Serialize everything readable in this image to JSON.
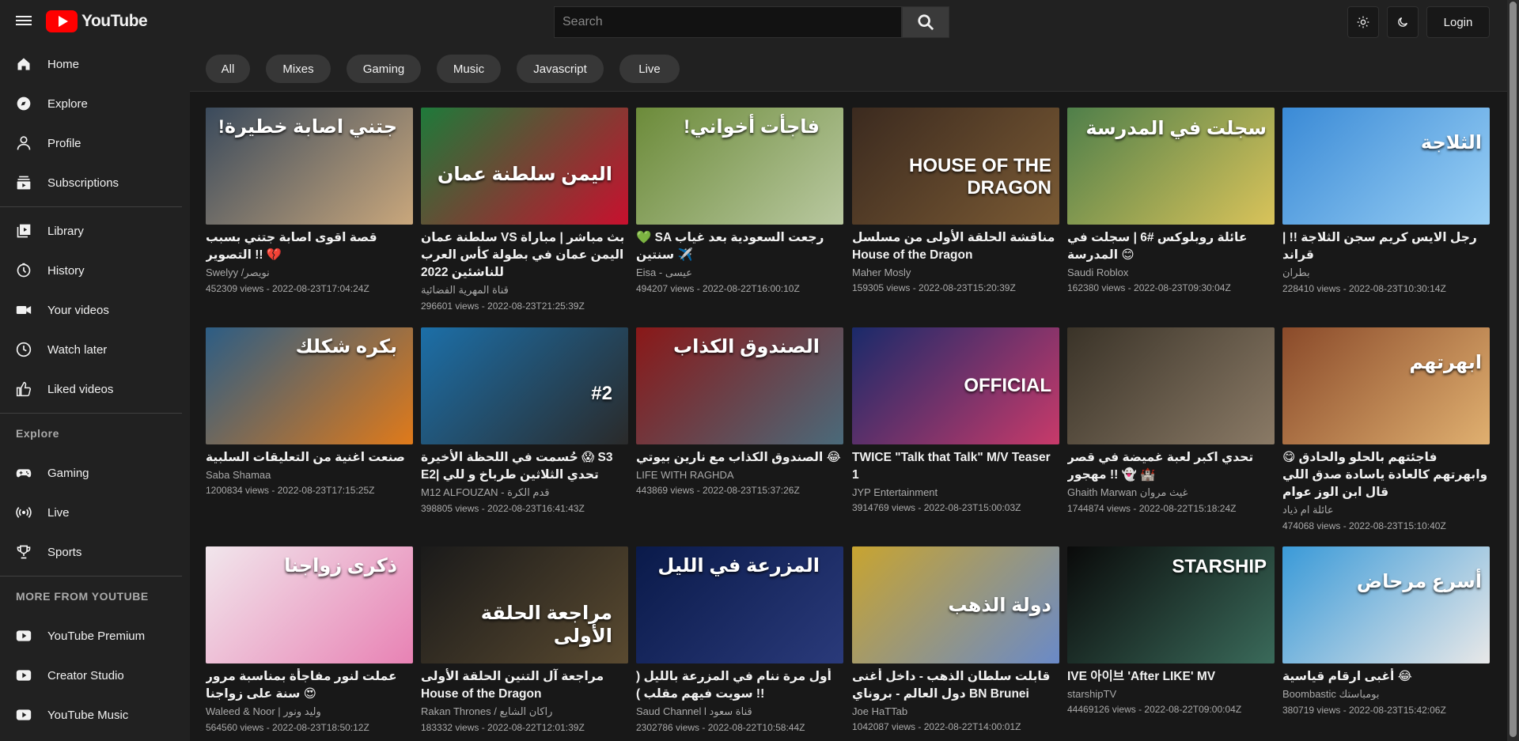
{
  "brand": {
    "name": "YouTube",
    "color": "#ff0000"
  },
  "search": {
    "placeholder": "Search"
  },
  "header": {
    "login_label": "Login",
    "light_icon": "sun-icon",
    "dark_icon": "moon-icon"
  },
  "sidebar": {
    "main": [
      {
        "label": "Home",
        "icon": "home-icon"
      },
      {
        "label": "Explore",
        "icon": "compass-icon"
      },
      {
        "label": "Profile",
        "icon": "user-icon"
      },
      {
        "label": "Subscriptions",
        "icon": "subscriptions-icon"
      }
    ],
    "library": [
      {
        "label": "Library",
        "icon": "library-icon"
      },
      {
        "label": "History",
        "icon": "history-icon"
      },
      {
        "label": "Your videos",
        "icon": "video-icon"
      },
      {
        "label": "Watch later",
        "icon": "clock-icon"
      },
      {
        "label": "Liked videos",
        "icon": "thumbs-up-icon"
      }
    ],
    "explore_heading": "Explore",
    "explore": [
      {
        "label": "Gaming",
        "icon": "gamepad-icon"
      },
      {
        "label": "Live",
        "icon": "live-icon"
      },
      {
        "label": "Sports",
        "icon": "trophy-icon"
      }
    ],
    "more_heading": "MORE FROM YOUTUBE",
    "more": [
      {
        "label": "YouTube Premium",
        "icon": "youtube-icon"
      },
      {
        "label": "Creator Studio",
        "icon": "youtube-icon"
      },
      {
        "label": "YouTube Music",
        "icon": "youtube-icon"
      }
    ]
  },
  "chips": [
    "All",
    "Mixes",
    "Gaming",
    "Music",
    "Javascript",
    "Live"
  ],
  "videos": [
    {
      "title": "قصة اقوى اصابة جتني بسبب التصوير !! 💔",
      "channel": "Swelyy /نويصر",
      "meta": "452309 views - 2022-08-23T17:04:24Z",
      "thumb_text": "جتني اصابة خطيرة!",
      "c1": "#3a4a5c",
      "c2": "#c9a77c"
    },
    {
      "title": "سلطنة عمان VS بث مباشر | مباراة اليمن عمان في بطولة كأس العرب للناشئين 2022",
      "channel": "قناة المهرية الفضائية",
      "meta": "296601 views - 2022-08-23T21:25:39Z",
      "thumb_text": "اليمن  سلطنة عمان",
      "c1": "#1e7a3a",
      "c2": "#c8102e"
    },
    {
      "title": "💚 SA رجعت السعودية بعد غياب سنتين ✈️",
      "channel": "Eisa - عيسى",
      "meta": "494207 views - 2022-08-22T16:00:10Z",
      "thumb_text": "فاجأت أخواني!",
      "c1": "#6c8b3a",
      "c2": "#b9c8a0"
    },
    {
      "title": "مناقشة الحلقة الأولى من مسلسل House of the Dragon",
      "channel": "Maher Mosly",
      "meta": "159305 views - 2022-08-23T15:20:39Z",
      "thumb_text": "HOUSE OF THE DRAGON",
      "c1": "#3b2a1f",
      "c2": "#7a5a34"
    },
    {
      "title": "عائلة روبلوكس #6 | سجلت في المدرسة 😊",
      "channel": "Saudi Roblox",
      "meta": "162380 views - 2022-08-23T09:30:04Z",
      "thumb_text": "سجلت في المدرسة",
      "c1": "#4f7f4a",
      "c2": "#d9c35a"
    },
    {
      "title": "رجل الايس كريم سجن الثلاجة !! | قراند",
      "channel": "بطران",
      "meta": "228410 views - 2022-08-23T10:30:14Z",
      "thumb_text": "الثلاجة",
      "c1": "#3a8ad6",
      "c2": "#9ad0f5"
    },
    {
      "title": "صنعت اغنية من التعليقات السلبية",
      "channel": "Saba Shamaa",
      "meta": "1200834 views - 2022-08-23T17:15:25Z",
      "thumb_text": "بكره شكلك",
      "c1": "#2c5d85",
      "c2": "#e07a1a"
    },
    {
      "title": "حُسمت في اللحظة الأخيرة 😱 S3 E2| تحدي الثلاثين طرباخ و للي",
      "channel": "M12 ALFOUZAN - قدم الكرة",
      "meta": "398805 views - 2022-08-23T16:41:43Z",
      "thumb_text": "#2",
      "c1": "#1c6fa8",
      "c2": "#2a2a2a"
    },
    {
      "title": "الصندوق الكذاب مع نارين بيوتي 😂",
      "channel": "LIFE WITH RAGHDA",
      "meta": "443869 views - 2022-08-23T15:37:26Z",
      "thumb_text": "الصندوق الكذاب",
      "c1": "#8a1818",
      "c2": "#4a6a7a"
    },
    {
      "title": "TWICE \"Talk that Talk\" M/V Teaser 1",
      "channel": "JYP Entertainment",
      "meta": "3914769 views - 2022-08-23T15:00:03Z",
      "thumb_text": "OFFICIAL",
      "c1": "#1a2a6a",
      "c2": "#c83a6a"
    },
    {
      "title": "تحدي اكبر لعبة غميضة في قصر مهجور !! 👻 🏰",
      "channel": "Ghaith Marwan غيث مروان",
      "meta": "1744874 views - 2022-08-22T15:18:24Z",
      "thumb_text": "",
      "c1": "#3a3328",
      "c2": "#8a7a66"
    },
    {
      "title": "فاجئتهم بالحلو والحادق 😋 وابهرتهم كالعادة ياسادة صدق اللي قال ابن الوز عوام",
      "channel": "عائلة ام ذياد",
      "meta": "474068 views - 2022-08-23T15:10:40Z",
      "thumb_text": "ابهرتهم",
      "c1": "#8a4a2a",
      "c2": "#e0b070"
    },
    {
      "title": "عملت لنور مفاجأة بمناسبة مرور سنة على زواجنا 😍",
      "channel": "Waleed & Noor | وليد ونور",
      "meta": "564560 views - 2022-08-23T18:50:12Z",
      "thumb_text": "ذكرى زواجنا",
      "c1": "#f1e6ec",
      "c2": "#e882b4"
    },
    {
      "title": "مراجعة آل التنين الحلقة الأولى House of the Dragon",
      "channel": "Rakan Thrones / راكان الشايع",
      "meta": "183332 views - 2022-08-22T12:01:39Z",
      "thumb_text": "مراجعة الحلقة الأولى",
      "c1": "#1a1a1a",
      "c2": "#5a4a30"
    },
    {
      "title": "أول مرة ننام في المزرعة بالليل ( سويت فيهم مقلب ) !!",
      "channel": "Saud Channel l قناة سعود",
      "meta": "2302786 views - 2022-08-22T10:58:44Z",
      "thumb_text": "المزرعة في الليل",
      "c1": "#0a1a4a",
      "c2": "#2a3a7a"
    },
    {
      "title": "قابلت سلطان الذهب - داخل أغنى دول العالم - بروناي BN Brunei",
      "channel": "Joe HaTTab",
      "meta": "1042087 views - 2022-08-22T14:00:01Z",
      "thumb_text": "دولة الذهب",
      "c1": "#c8a430",
      "c2": "#6a8ac8"
    },
    {
      "title": "IVE 아이브 'After LIKE' MV",
      "channel": "starshipTV",
      "meta": "44469126 views - 2022-08-22T09:00:04Z",
      "thumb_text": "STARSHIP",
      "c1": "#0a0a0a",
      "c2": "#3a6a5a"
    },
    {
      "title": "أغبى ارقام قياسية 😂",
      "channel": "Boombastic بومباستك",
      "meta": "380719 views - 2022-08-23T15:42:06Z",
      "thumb_text": "أسرع مرحاض",
      "c1": "#3a9ad8",
      "c2": "#e8e8e8"
    }
  ]
}
